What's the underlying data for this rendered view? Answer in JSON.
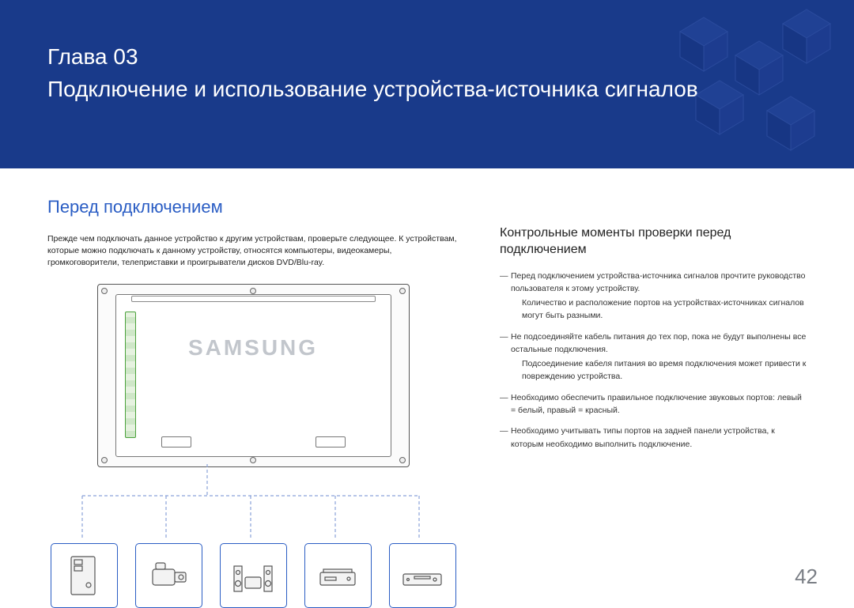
{
  "chapter_label": "Глава 03",
  "title": "Подключение и использование устройства-источника сигналов",
  "section_title": "Перед подключением",
  "intro": "Прежде чем подключать данное устройство к другим устройствам, проверьте следующее. К устройствам, которые можно подключать к данному устройству, относятся компьютеры, видеокамеры, громкоговорители, телеприставки и проигрыватели дисков DVD/Blu-ray.",
  "subheading": "Контрольные моменты проверки перед подключением",
  "checklist": [
    {
      "main": "Перед подключением устройства-источника сигналов прочтите руководство пользователя к этому устройству.",
      "sub": "Количество и расположение портов на устройствах-источниках сигналов могут быть разными."
    },
    {
      "main": "Не подсоединяйте кабель питания до тех пор, пока не будут выполнены все остальные подключения.",
      "sub": "Подсоединение кабеля питания во время подключения может привести к повреждению устройства."
    },
    {
      "main": "Необходимо обеспечить правильное подключение звуковых портов: левый = белый, правый = красный.",
      "sub": ""
    },
    {
      "main": "Необходимо учитывать типы портов на задней панели устройства, к которым необходимо выполнить подключение.",
      "sub": ""
    }
  ],
  "brand": "SAMSUNG",
  "devices": [
    "pc-tower",
    "camcorder",
    "speaker-set",
    "set-top-box",
    "dvd-player"
  ],
  "page_number": "42"
}
